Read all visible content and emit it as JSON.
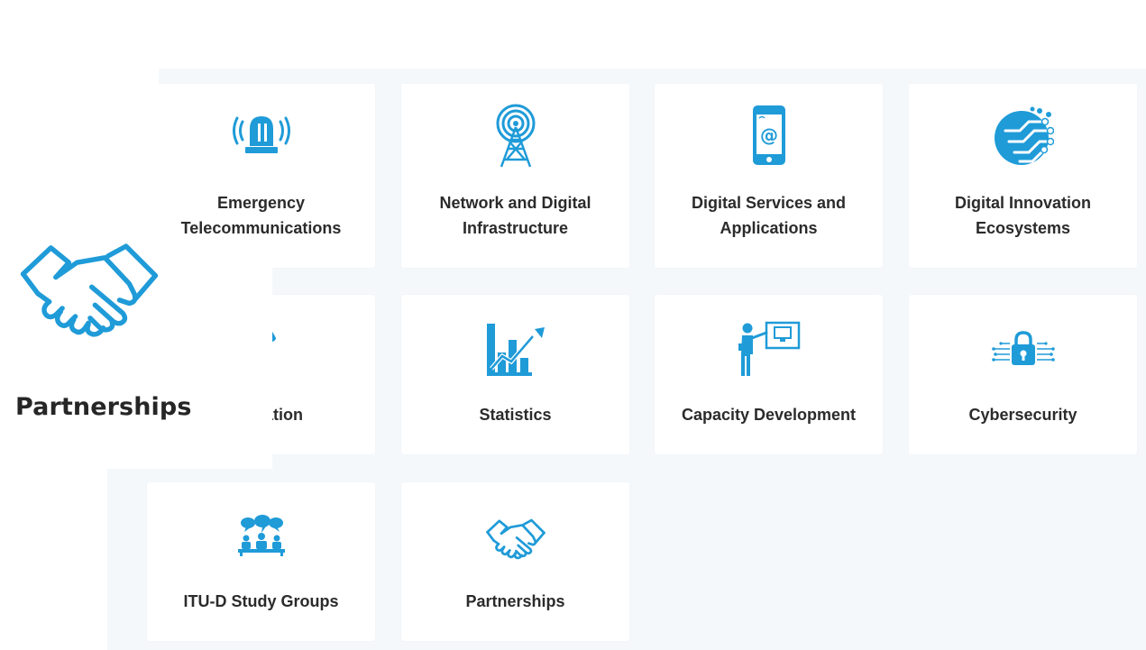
{
  "tiles": [
    {
      "icon": "emergency-siren-icon",
      "lines": [
        "Emergency",
        "Telecommunications"
      ]
    },
    {
      "icon": "radio-tower-icon",
      "lines": [
        "Network and Digital",
        "Infrastructure"
      ]
    },
    {
      "icon": "smartphone-at-icon",
      "lines": [
        "Digital Services and",
        "Applications"
      ]
    },
    {
      "icon": "circuit-globe-icon",
      "lines": [
        "Digital Innovation",
        "Ecosystems"
      ]
    },
    {
      "icon": "gavel-icon",
      "lines": [
        "Regulation"
      ]
    },
    {
      "icon": "bar-chart-arrow-icon",
      "lines": [
        "Statistics"
      ]
    },
    {
      "icon": "presenter-board-icon",
      "lines": [
        "Capacity Development"
      ]
    },
    {
      "icon": "circuit-padlock-icon",
      "lines": [
        "Cybersecurity"
      ]
    },
    {
      "icon": "meeting-group-icon",
      "lines": [
        "ITU-D Study Groups"
      ]
    },
    {
      "icon": "handshake-icon",
      "lines": [
        "Partnerships"
      ]
    }
  ],
  "hover_card": {
    "icon": "handshake-icon",
    "label": "Partnerships"
  },
  "colors": {
    "accent": "#1f9bd8",
    "text": "#2b2b2b",
    "grid_bg": "#f5f8fb",
    "tile_bg": "#ffffff"
  }
}
